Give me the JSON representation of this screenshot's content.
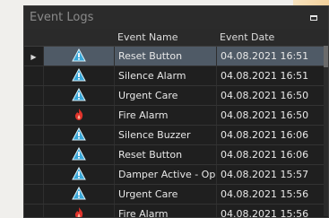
{
  "window": {
    "title": "Event Logs"
  },
  "columns": {
    "name": "Event Name",
    "date": "Event Date"
  },
  "rows": [
    {
      "icon": "warning-icon",
      "name": "Reset Button",
      "date": "04.08.2021 16:51",
      "selected": true
    },
    {
      "icon": "warning-icon",
      "name": "Silence Alarm",
      "date": "04.08.2021 16:51"
    },
    {
      "icon": "warning-icon",
      "name": "Urgent Care",
      "date": "04.08.2021 16:50"
    },
    {
      "icon": "fire-icon",
      "name": "Fire Alarm",
      "date": "04.08.2021 16:50"
    },
    {
      "icon": "warning-icon",
      "name": "Silence Buzzer",
      "date": "04.08.2021 16:06"
    },
    {
      "icon": "warning-icon",
      "name": "Reset Button",
      "date": "04.08.2021 16:06"
    },
    {
      "icon": "warning-icon",
      "name": "Damper Active - Open",
      "date": "04.08.2021 15:57"
    },
    {
      "icon": "warning-icon",
      "name": "Urgent Care",
      "date": "04.08.2021 15:56"
    },
    {
      "icon": "fire-icon",
      "name": "Fire Alarm",
      "date": "04.08.2021 15:56"
    }
  ],
  "colors": {
    "selection": "#4f5a66",
    "warning": "#39a7d8",
    "fire": "#e0332b"
  }
}
